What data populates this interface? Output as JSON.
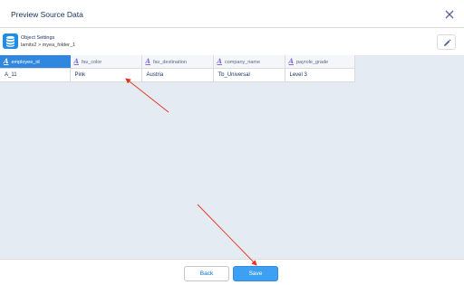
{
  "modal": {
    "title": "Preview Source Data"
  },
  "subheader": {
    "title": "Object Settings",
    "path": "lamits2 > myea_folder_1"
  },
  "grid": {
    "columns": [
      {
        "label": "employee_id"
      },
      {
        "label": "fav_color"
      },
      {
        "label": "fav_destination"
      },
      {
        "label": "company_name"
      },
      {
        "label": "payrole_grade"
      }
    ],
    "type_marker": "A",
    "rows": [
      [
        "A_11",
        "Pink",
        "Austria",
        "Tb_Universal",
        "Level 3"
      ]
    ]
  },
  "footer": {
    "back_label": "Back",
    "save_label": "Save"
  },
  "colors": {
    "accent": "#2f87e0",
    "save_button": "#3ea0f2",
    "annotation_arrow": "#e8321f",
    "background": "#e5ebf3"
  },
  "icons": {
    "close": "close-icon",
    "database": "database-icon",
    "edit": "pencil-icon"
  }
}
